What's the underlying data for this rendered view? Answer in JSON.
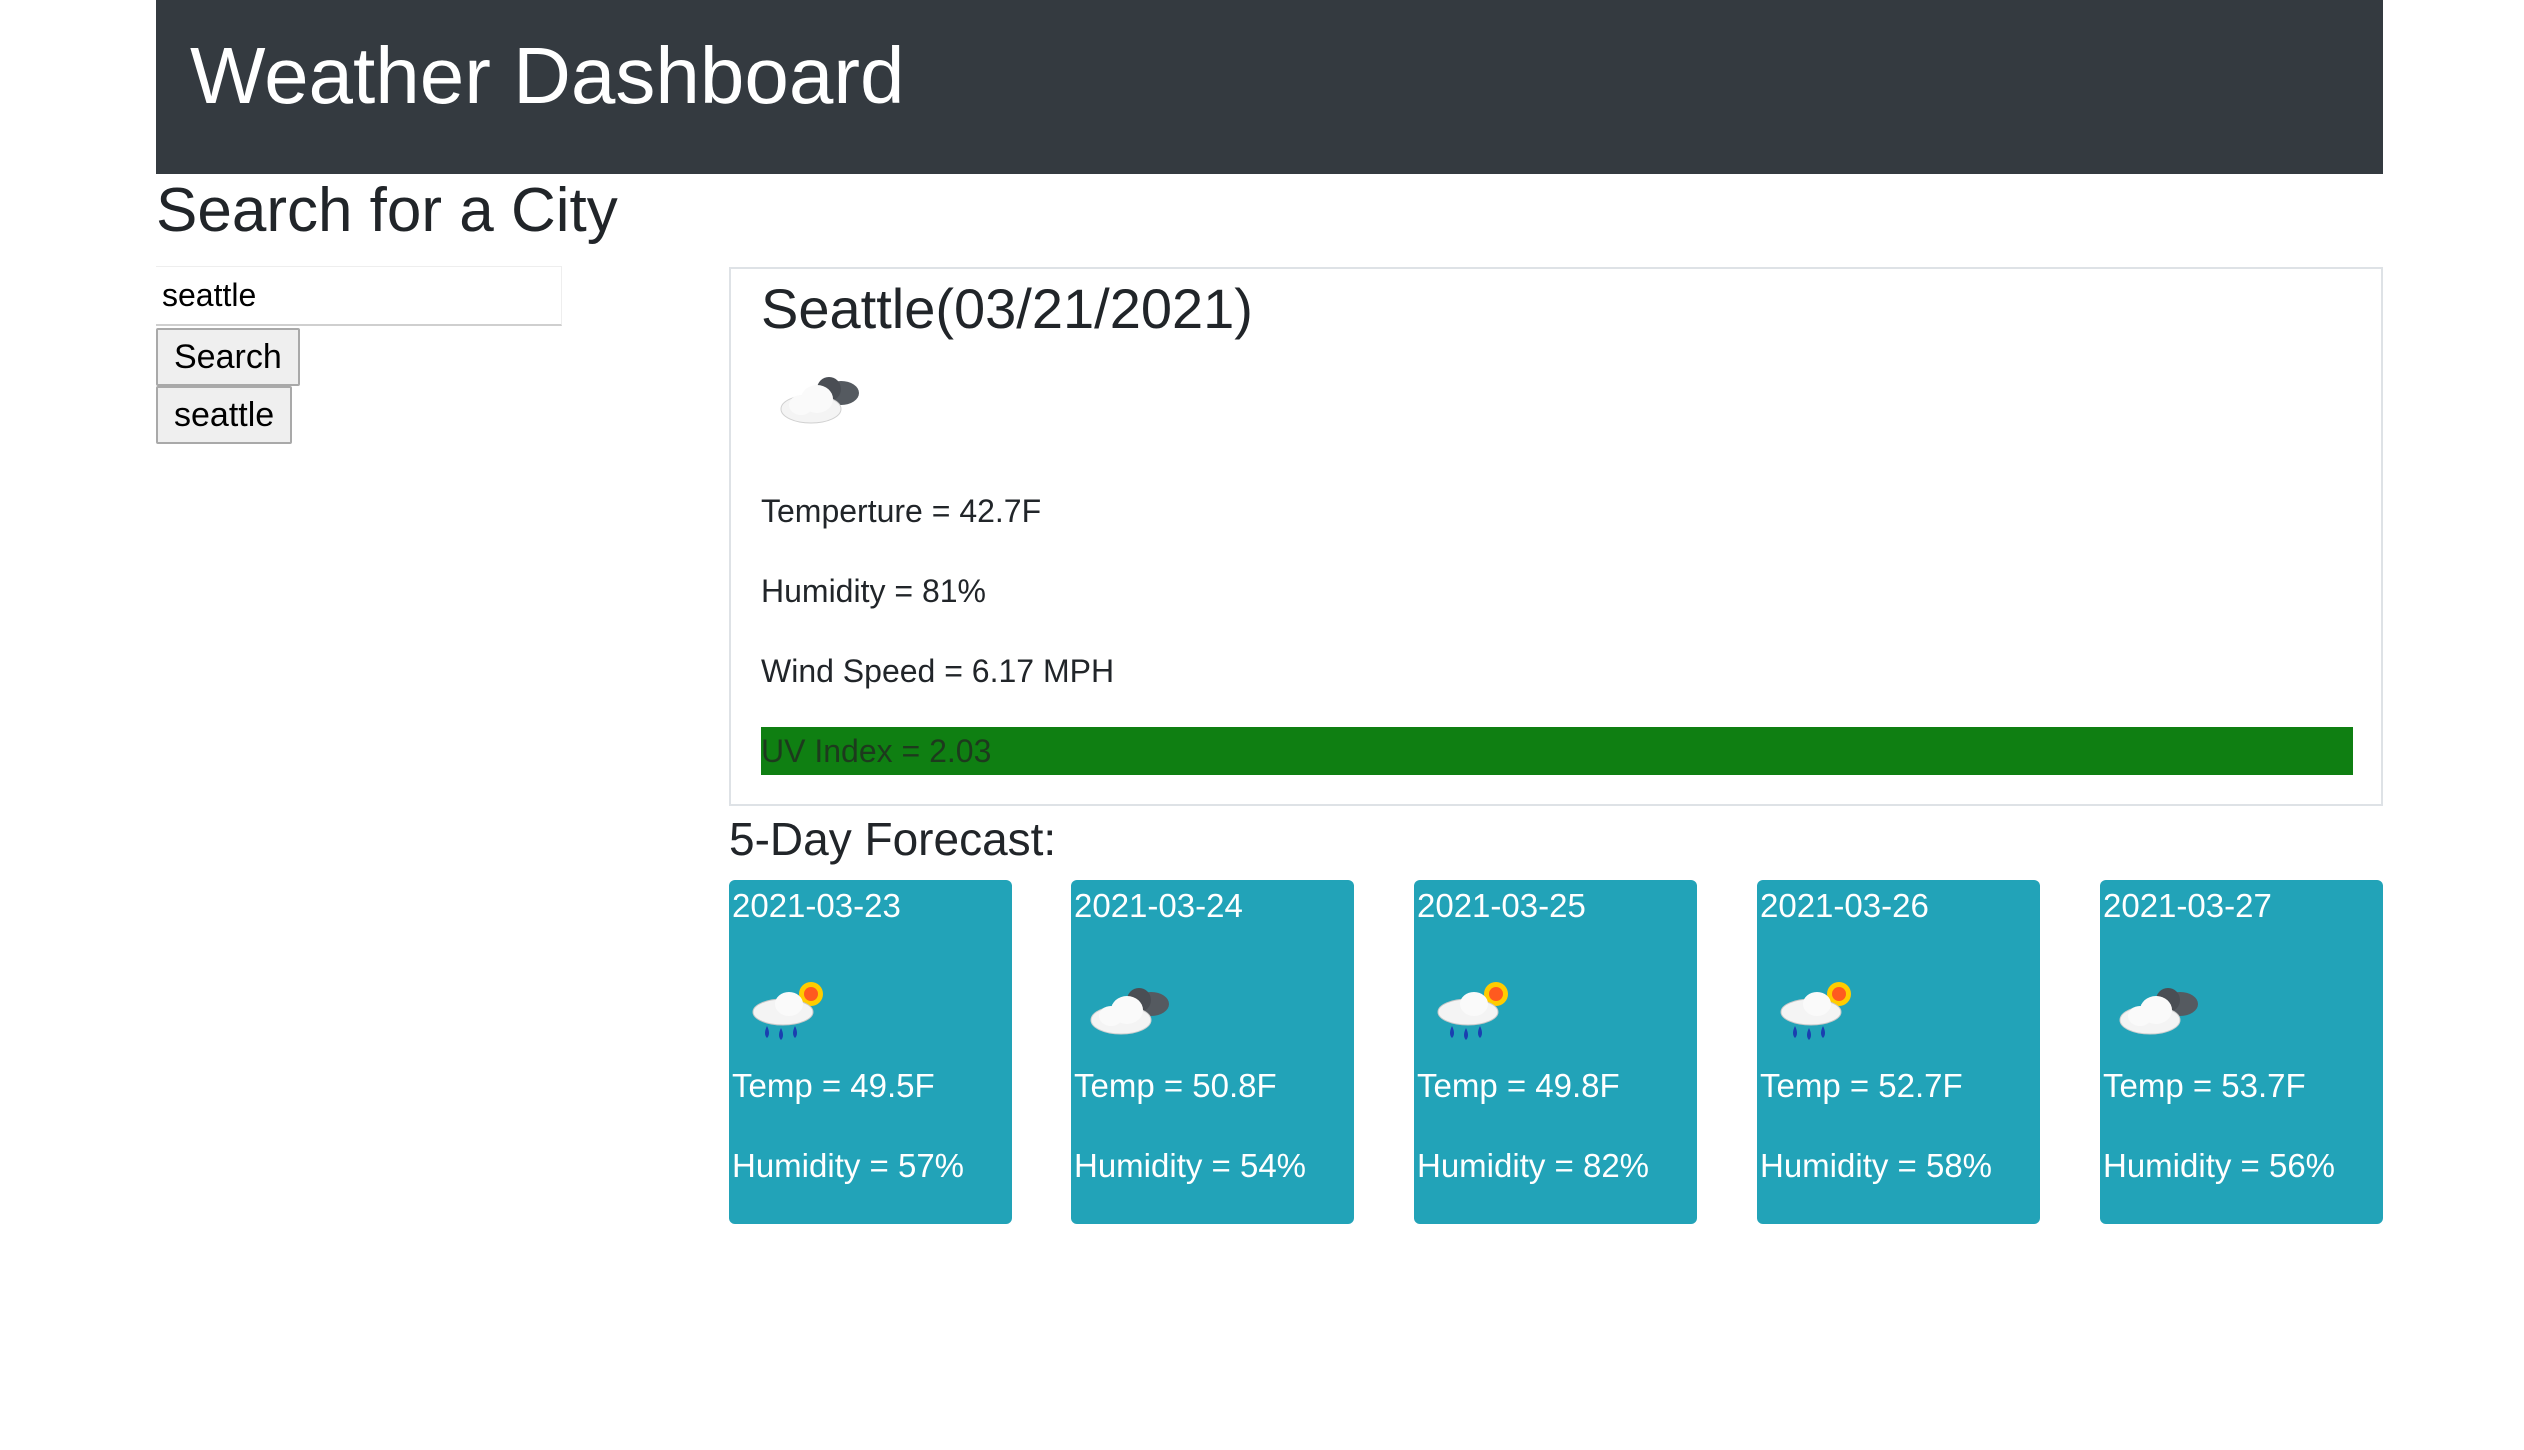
{
  "header": {
    "title": "Weather Dashboard"
  },
  "search": {
    "title": "Search for a City",
    "input_value": "seattle",
    "button_label": "Search",
    "history": [
      "seattle"
    ]
  },
  "current": {
    "heading": "Seattle(03/21/2021)",
    "icon": "cloudy-icon",
    "temperature": "Temperture = 42.7F",
    "humidity": "Humidity = 81%",
    "wind": "Wind Speed = 6.17 MPH",
    "uv": "UV Index = 2.03",
    "uv_color": "#0f7f12"
  },
  "forecast": {
    "title": "5-Day Forecast:",
    "card_color": "#22a3b8",
    "days": [
      {
        "date": "2021-03-23",
        "icon": "rain-sun-icon",
        "temp": "Temp = 49.5F",
        "humidity": "Humidity = 57%"
      },
      {
        "date": "2021-03-24",
        "icon": "cloudy-icon",
        "temp": "Temp = 50.8F",
        "humidity": "Humidity = 54%"
      },
      {
        "date": "2021-03-25",
        "icon": "rain-sun-icon",
        "temp": "Temp = 49.8F",
        "humidity": "Humidity = 82%"
      },
      {
        "date": "2021-03-26",
        "icon": "rain-sun-icon",
        "temp": "Temp = 52.7F",
        "humidity": "Humidity = 58%"
      },
      {
        "date": "2021-03-27",
        "icon": "cloudy-icon",
        "temp": "Temp = 53.7F",
        "humidity": "Humidity = 56%"
      }
    ]
  }
}
